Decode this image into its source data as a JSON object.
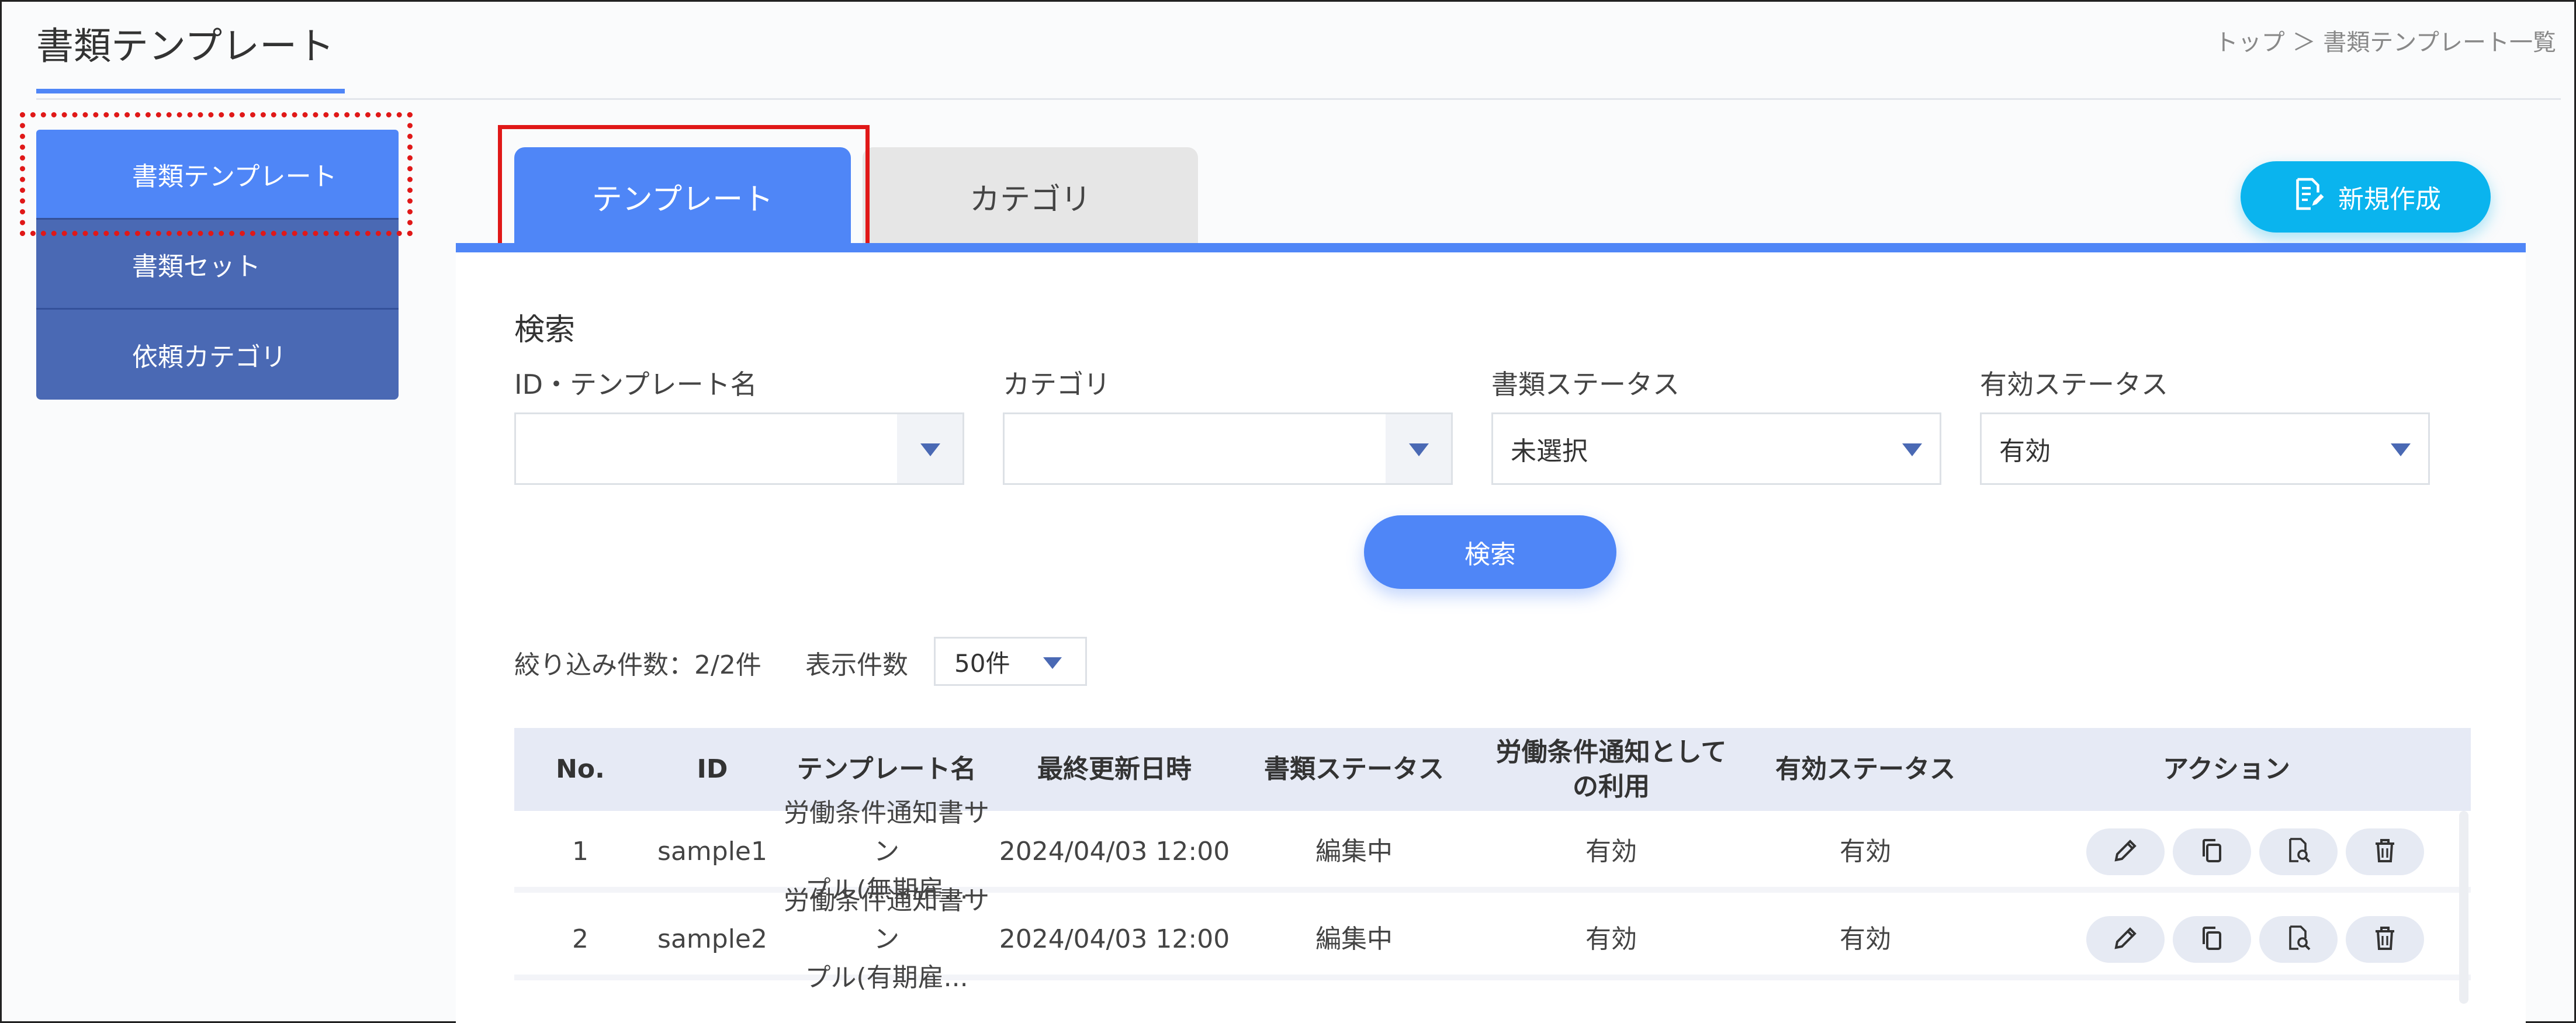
{
  "header": {
    "title": "書類テンプレート",
    "breadcrumb": "トップ ＞ 書類テンプレート一覧"
  },
  "sidebar": {
    "items": [
      {
        "label": "書類テンプレート"
      },
      {
        "label": "書類セット"
      },
      {
        "label": "依頼カテゴリ"
      }
    ]
  },
  "tabs": [
    {
      "label": "テンプレート"
    },
    {
      "label": "カテゴリ"
    }
  ],
  "new_button": {
    "label": "新規作成",
    "icon": "document-edit-icon"
  },
  "search": {
    "title": "検索",
    "fields": [
      {
        "label": "ID・テンプレート名",
        "value": ""
      },
      {
        "label": "カテゴリ",
        "value": ""
      },
      {
        "label": "書類ステータス",
        "value": "未選択"
      },
      {
        "label": "有効ステータス",
        "value": "有効"
      }
    ],
    "button": "検索"
  },
  "results": {
    "filter_count": "絞り込み件数：2/2件",
    "display_label": "表示件数",
    "display_value": "50件"
  },
  "table": {
    "headers": [
      "No.",
      "ID",
      "テンプレート名",
      "最終更新日時",
      "書類ステータス",
      "労働条件通知として\nの利用",
      "有効ステータス",
      "アクション"
    ],
    "rows": [
      {
        "no": "1",
        "id": "sample1",
        "name": "労働条件通知書サン\nプル(無期雇...",
        "updated": "2024/04/03 12:00",
        "doc_status": "編集中",
        "labor_use": "有効",
        "active_status": "有効"
      },
      {
        "no": "2",
        "id": "sample2",
        "name": "労働条件通知書サン\nプル(有期雇...",
        "updated": "2024/04/03 12:00",
        "doc_status": "編集中",
        "labor_use": "有効",
        "active_status": "有効"
      }
    ],
    "actions": [
      "edit-pencil-icon",
      "copy-icon",
      "preview-magnify-icon",
      "trash-icon"
    ]
  },
  "colors": {
    "accent": "#4f86f7",
    "sidebar": "#4a69b4",
    "new_button": "#0ab4ee",
    "highlight": "#e01818"
  }
}
